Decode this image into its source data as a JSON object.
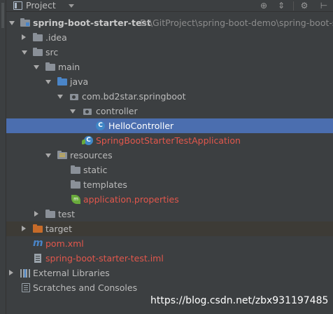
{
  "panel": {
    "title": "Project",
    "buttons": {
      "locate": "⊕",
      "collapse": "⇕",
      "settings": "⚙",
      "hide": "⊢"
    }
  },
  "tree": {
    "root": {
      "label": "spring-boot-starter-test",
      "path": "D:\\GitProject\\spring-boot-demo\\spring-boot-st"
    },
    "idea": ".idea",
    "src": "src",
    "main": "main",
    "java": "java",
    "package": "com.bd2star.springboot",
    "controller": "controller",
    "hello_controller": "HelloController",
    "app_class": "SpringBootStarterTestApplication",
    "resources": "resources",
    "static": "static",
    "templates": "templates",
    "app_properties": "application.properties",
    "test": "test",
    "target": "target",
    "pom": "pom.xml",
    "iml": "spring-boot-starter-test.iml",
    "external_libraries": "External Libraries",
    "scratches": "Scratches and Consoles"
  },
  "icons": {
    "class_letter": "C",
    "spring_letter": "m",
    "maven_letter": "m"
  },
  "watermark": "https://blog.csdn.net/zbx931197485",
  "colors": {
    "background": "#3c3f41",
    "selection": "#4b6eaf",
    "modified_red": "#e2574c",
    "source_folder_blue": "#4a85c8",
    "excluded_orange": "#c76b29"
  }
}
